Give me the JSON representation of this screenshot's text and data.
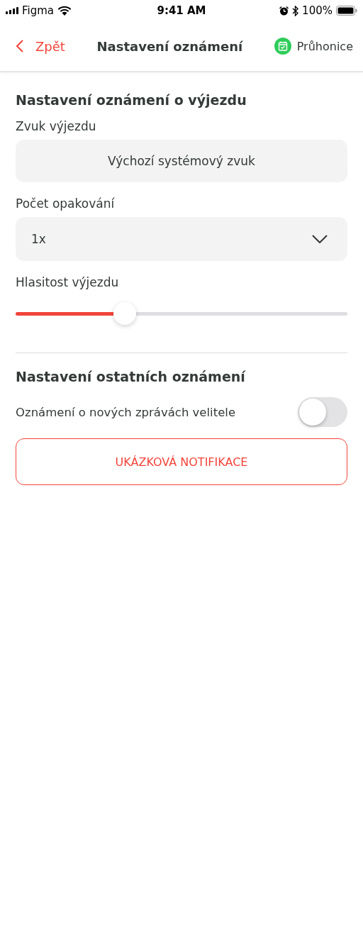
{
  "status_bar": {
    "carrier": "Figma",
    "time": "9:41 AM",
    "battery": "100%"
  },
  "nav": {
    "back": "Zpět",
    "title": "Nastavení oznámení",
    "location": "Průhonice"
  },
  "sections": [
    {
      "heading": "Nastavení oznámení o výjezdu",
      "items": [
        {
          "kind": "button-field",
          "label": "Zvuk výjezdu",
          "value": "Výchozí systémový zvuk"
        },
        {
          "kind": "select",
          "label": "Počet opakování",
          "value": "1x"
        },
        {
          "kind": "slider",
          "label": "Hlasitost výjezdu",
          "level": 0.33
        }
      ]
    },
    {
      "heading": "Nastavení ostatních oznámení",
      "items": [
        {
          "kind": "toggle",
          "label": "Oznámení o nových zprávách velitele",
          "on": false
        },
        {
          "kind": "outline-button",
          "label": "UKÁZKOVÁ NOTIFIKACE"
        }
      ]
    }
  ]
}
